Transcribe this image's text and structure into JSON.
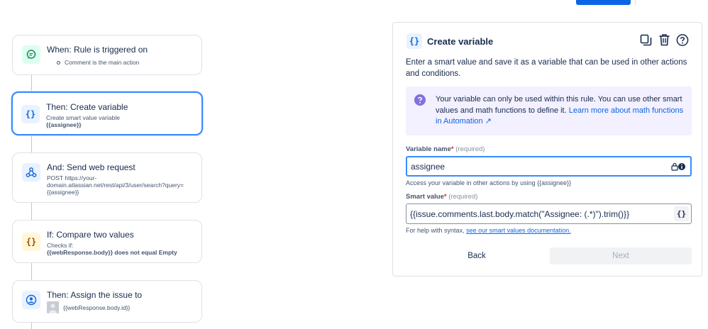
{
  "flow": {
    "cards": [
      {
        "title": "When: Rule is triggered on",
        "sub": "Comment is the main action"
      },
      {
        "title": "Then: Create variable",
        "sub1": "Create smart value variable",
        "sub2": "{{assignee}}"
      },
      {
        "title": "And: Send web request",
        "sub1": "POST https://your-",
        "sub2": "domain.atlassian.net/rest/api/3/user/search?query=",
        "sub3": "{{assignee}}"
      },
      {
        "title": "If: Compare two values",
        "sub1": "Checks if:",
        "sub2": "{{webResponse.body}} does not equal Empty"
      },
      {
        "title": "Then: Assign the issue to",
        "sub": "{{webResponse.body.id}}"
      }
    ]
  },
  "panel": {
    "icon": "{}",
    "title": "Create variable",
    "description": "Enter a smart value and save it as a variable that can be used in other actions and conditions.",
    "info_text": "Your variable can only be used within this rule. You can use other smart values and math functions to define it.",
    "info_link": "Learn more about math functions in Automation ↗",
    "variable_name_label": "Variable name",
    "required_mark": "*",
    "required_text": "(required)",
    "variable_name_value": "assignee",
    "variable_name_helper": "Access your variable in other actions by using {{assignee}}",
    "smart_value_label": "Smart value",
    "smart_value_value": "{{issue.comments.last.body.match(\"Assignee: (.*)\").trim()}}",
    "smart_value_button": "{}",
    "smart_value_helper": "For help with syntax,",
    "smart_value_link": "see our smart values documentation.",
    "back_label": "Back",
    "next_label": "Next"
  },
  "colors": {
    "accent": "#0c66e4",
    "selected_border": "#388bff",
    "info_bg": "#f3f0ff",
    "info_icon": "#8270db",
    "trigger_icon_bg": "#dcfff1",
    "condition_icon_bg": "#fff7d6"
  },
  "icons": {
    "trigger": "chat-bubble-icon",
    "action": "curly-braces-icon",
    "web": "webhook-icon",
    "condition": "curly-braces-icon",
    "assign": "user-avatar-icon",
    "copy": "copy-icon",
    "delete": "trash-icon",
    "help": "question-circle-icon"
  }
}
